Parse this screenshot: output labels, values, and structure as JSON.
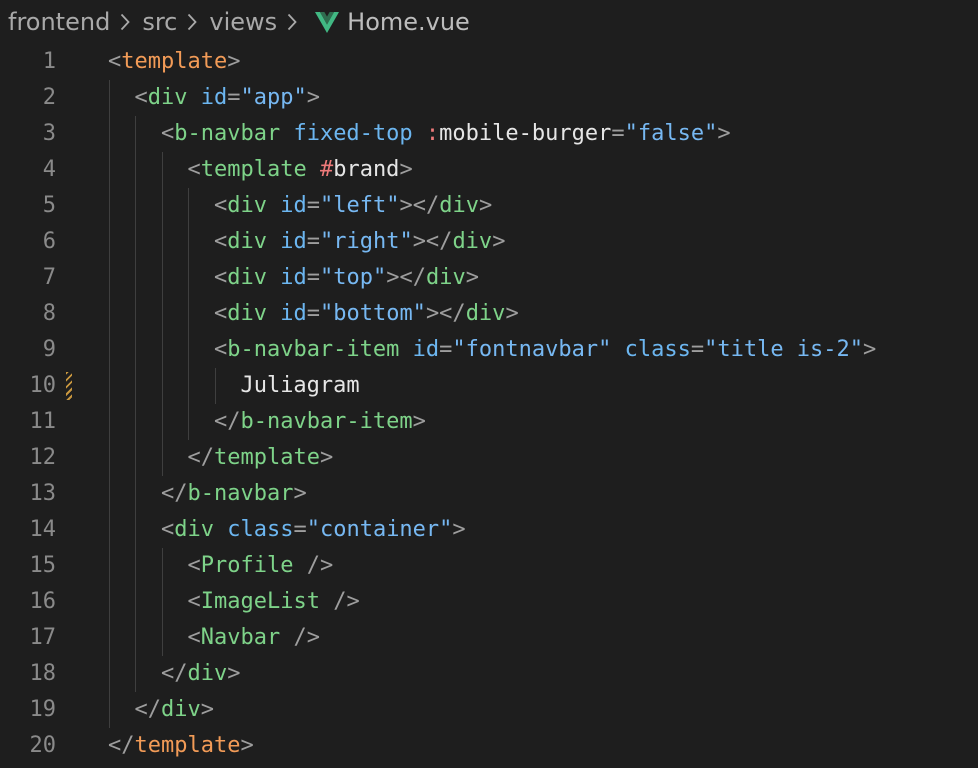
{
  "breadcrumb": {
    "items": [
      "frontend",
      "src",
      "views"
    ],
    "file": "Home.vue",
    "file_icon": "vue-logo-icon",
    "vue_color": "#41b883"
  },
  "colors": {
    "background": "#1e1e1e",
    "line_number": "#8a8a8a",
    "punctuation": "#9e9e9e",
    "html_tag": "#f29b57",
    "component_tag": "#7ed389",
    "attribute": "#6cb6f0",
    "string": "#77b8f2",
    "directive": "#ef7a7a",
    "text": "#e6e6e6"
  },
  "editor": {
    "modified_line": 10,
    "lines": [
      {
        "n": "1",
        "indent": "",
        "tokens": [
          [
            "punc",
            "<"
          ],
          [
            "tag",
            "template"
          ],
          [
            "punc",
            ">"
          ]
        ]
      },
      {
        "n": "2",
        "indent": "  ",
        "tokens": [
          [
            "punc",
            "<"
          ],
          [
            "comp",
            "div"
          ],
          [
            "text",
            " "
          ],
          [
            "attr",
            "id"
          ],
          [
            "punc",
            "="
          ],
          [
            "str",
            "\"app\""
          ],
          [
            "punc",
            ">"
          ]
        ]
      },
      {
        "n": "3",
        "indent": "    ",
        "tokens": [
          [
            "punc",
            "<"
          ],
          [
            "comp",
            "b-navbar"
          ],
          [
            "text",
            " "
          ],
          [
            "attr",
            "fixed-top"
          ],
          [
            "text",
            " "
          ],
          [
            "dir",
            ":"
          ],
          [
            "text",
            "mobile-burger"
          ],
          [
            "punc",
            "="
          ],
          [
            "str",
            "\"false\""
          ],
          [
            "punc",
            ">"
          ]
        ]
      },
      {
        "n": "4",
        "indent": "      ",
        "tokens": [
          [
            "punc",
            "<"
          ],
          [
            "comp",
            "template"
          ],
          [
            "text",
            " "
          ],
          [
            "dir",
            "#"
          ],
          [
            "text",
            "brand"
          ],
          [
            "punc",
            ">"
          ]
        ]
      },
      {
        "n": "5",
        "indent": "        ",
        "tokens": [
          [
            "punc",
            "<"
          ],
          [
            "comp",
            "div"
          ],
          [
            "text",
            " "
          ],
          [
            "attr",
            "id"
          ],
          [
            "punc",
            "="
          ],
          [
            "str",
            "\"left\""
          ],
          [
            "punc",
            "></"
          ],
          [
            "comp",
            "div"
          ],
          [
            "punc",
            ">"
          ]
        ]
      },
      {
        "n": "6",
        "indent": "        ",
        "tokens": [
          [
            "punc",
            "<"
          ],
          [
            "comp",
            "div"
          ],
          [
            "text",
            " "
          ],
          [
            "attr",
            "id"
          ],
          [
            "punc",
            "="
          ],
          [
            "str",
            "\"right\""
          ],
          [
            "punc",
            "></"
          ],
          [
            "comp",
            "div"
          ],
          [
            "punc",
            ">"
          ]
        ]
      },
      {
        "n": "7",
        "indent": "        ",
        "tokens": [
          [
            "punc",
            "<"
          ],
          [
            "comp",
            "div"
          ],
          [
            "text",
            " "
          ],
          [
            "attr",
            "id"
          ],
          [
            "punc",
            "="
          ],
          [
            "str",
            "\"top\""
          ],
          [
            "punc",
            "></"
          ],
          [
            "comp",
            "div"
          ],
          [
            "punc",
            ">"
          ]
        ]
      },
      {
        "n": "8",
        "indent": "        ",
        "tokens": [
          [
            "punc",
            "<"
          ],
          [
            "comp",
            "div"
          ],
          [
            "text",
            " "
          ],
          [
            "attr",
            "id"
          ],
          [
            "punc",
            "="
          ],
          [
            "str",
            "\"bottom\""
          ],
          [
            "punc",
            "></"
          ],
          [
            "comp",
            "div"
          ],
          [
            "punc",
            ">"
          ]
        ]
      },
      {
        "n": "9",
        "indent": "        ",
        "tokens": [
          [
            "punc",
            "<"
          ],
          [
            "comp",
            "b-navbar-item"
          ],
          [
            "text",
            " "
          ],
          [
            "attr",
            "id"
          ],
          [
            "punc",
            "="
          ],
          [
            "str",
            "\"fontnavbar\""
          ],
          [
            "text",
            " "
          ],
          [
            "attr",
            "class"
          ],
          [
            "punc",
            "="
          ],
          [
            "str",
            "\"title is-2\""
          ],
          [
            "punc",
            ">"
          ]
        ]
      },
      {
        "n": "10",
        "indent": "          ",
        "tokens": [
          [
            "text",
            "Juliagram"
          ]
        ]
      },
      {
        "n": "11",
        "indent": "        ",
        "tokens": [
          [
            "punc",
            "</"
          ],
          [
            "comp",
            "b-navbar-item"
          ],
          [
            "punc",
            ">"
          ]
        ]
      },
      {
        "n": "12",
        "indent": "      ",
        "tokens": [
          [
            "punc",
            "</"
          ],
          [
            "comp",
            "template"
          ],
          [
            "punc",
            ">"
          ]
        ]
      },
      {
        "n": "13",
        "indent": "    ",
        "tokens": [
          [
            "punc",
            "</"
          ],
          [
            "comp",
            "b-navbar"
          ],
          [
            "punc",
            ">"
          ]
        ]
      },
      {
        "n": "14",
        "indent": "    ",
        "tokens": [
          [
            "punc",
            "<"
          ],
          [
            "comp",
            "div"
          ],
          [
            "text",
            " "
          ],
          [
            "attr",
            "class"
          ],
          [
            "punc",
            "="
          ],
          [
            "str",
            "\"container\""
          ],
          [
            "punc",
            ">"
          ]
        ]
      },
      {
        "n": "15",
        "indent": "      ",
        "tokens": [
          [
            "punc",
            "<"
          ],
          [
            "comp",
            "Profile"
          ],
          [
            "text",
            " "
          ],
          [
            "punc",
            "/>"
          ]
        ]
      },
      {
        "n": "16",
        "indent": "      ",
        "tokens": [
          [
            "punc",
            "<"
          ],
          [
            "comp",
            "ImageList"
          ],
          [
            "text",
            " "
          ],
          [
            "punc",
            "/>"
          ]
        ]
      },
      {
        "n": "17",
        "indent": "      ",
        "tokens": [
          [
            "punc",
            "<"
          ],
          [
            "comp",
            "Navbar"
          ],
          [
            "text",
            " "
          ],
          [
            "punc",
            "/>"
          ]
        ]
      },
      {
        "n": "18",
        "indent": "    ",
        "tokens": [
          [
            "punc",
            "</"
          ],
          [
            "comp",
            "div"
          ],
          [
            "punc",
            ">"
          ]
        ]
      },
      {
        "n": "19",
        "indent": "  ",
        "tokens": [
          [
            "punc",
            "</"
          ],
          [
            "comp",
            "div"
          ],
          [
            "punc",
            ">"
          ]
        ]
      },
      {
        "n": "20",
        "indent": "",
        "tokens": [
          [
            "punc",
            "</"
          ],
          [
            "tag",
            "template"
          ],
          [
            "punc",
            ">"
          ]
        ]
      }
    ]
  }
}
